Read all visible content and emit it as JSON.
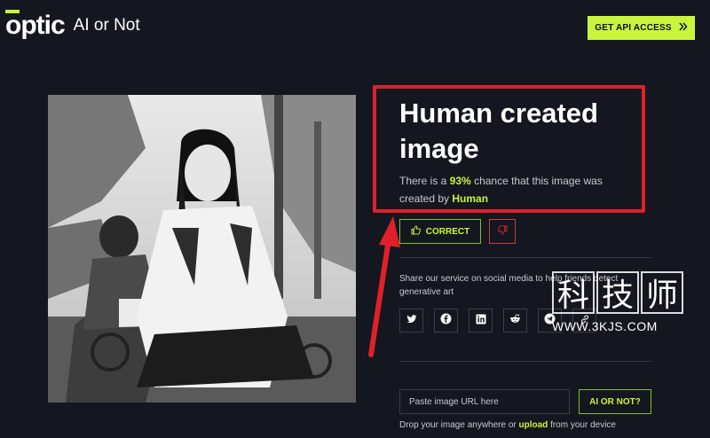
{
  "header": {
    "logo_text": "optic",
    "product_name": "AI or Not",
    "api_button_label": "GET API ACCESS",
    "api_button_icon": "double-chevron-right-icon",
    "accent_color": "#c8f53c"
  },
  "result": {
    "title": "Human created image",
    "desc_prefix": "There is a ",
    "percent": "93%",
    "desc_middle": " chance that this image was created by ",
    "source": "Human",
    "highlight_color": "#e0202a"
  },
  "feedback": {
    "correct_label": "CORRECT",
    "correct_icon": "thumbs-up-icon",
    "wrong_icon": "thumbs-down-icon"
  },
  "share": {
    "text": "Share our service on social media to help friends detect generative art",
    "icons": [
      "twitter-icon",
      "facebook-icon",
      "linkedin-icon",
      "reddit-icon",
      "telegram-icon",
      "link-icon"
    ]
  },
  "upload": {
    "url_placeholder": "Paste image URL here",
    "submit_label": "AI OR NOT?",
    "drop_prefix": "Drop your image anywhere or ",
    "drop_link": "upload",
    "drop_suffix": " from your device"
  },
  "watermark": {
    "chars": [
      "科",
      "技",
      "师"
    ],
    "url": "WWW.3KJS.COM"
  }
}
